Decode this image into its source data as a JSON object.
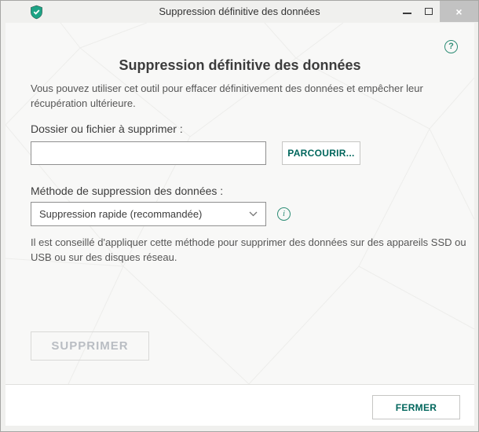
{
  "window": {
    "title": "Suppression définitive des données",
    "controls": {
      "close_glyph": "×"
    }
  },
  "main": {
    "help_glyph": "?",
    "heading": "Suppression définitive des données",
    "description": "Vous pouvez utiliser cet outil pour effacer définitivement des données et empêcher leur récupération ultérieure.",
    "file_section": {
      "label": "Dossier ou fichier à supprimer :",
      "input_value": "",
      "input_placeholder": "",
      "browse_button": "PARCOURIR..."
    },
    "method_section": {
      "label": "Méthode de suppression des données :",
      "selected_option": "Suppression rapide (recommandée)",
      "info_glyph": "i",
      "hint": "Il est conseillé d'appliquer cette méthode pour supprimer des données sur des appareils SSD ou USB ou sur des disques réseau."
    },
    "delete_button": "SUPPRIMER"
  },
  "footer": {
    "close_button": "FERMER"
  },
  "colors": {
    "brand_shield_green": "#1ea385",
    "icon_green": "#2e8d76",
    "button_text_teal": "#00665c",
    "disabled_text": "#b9bdc3",
    "titlebar_bg": "#f0f0ee",
    "content_bg": "#f8f8f7",
    "footer_bg": "#ffffff",
    "close_button_bg": "#c2c2c2"
  }
}
